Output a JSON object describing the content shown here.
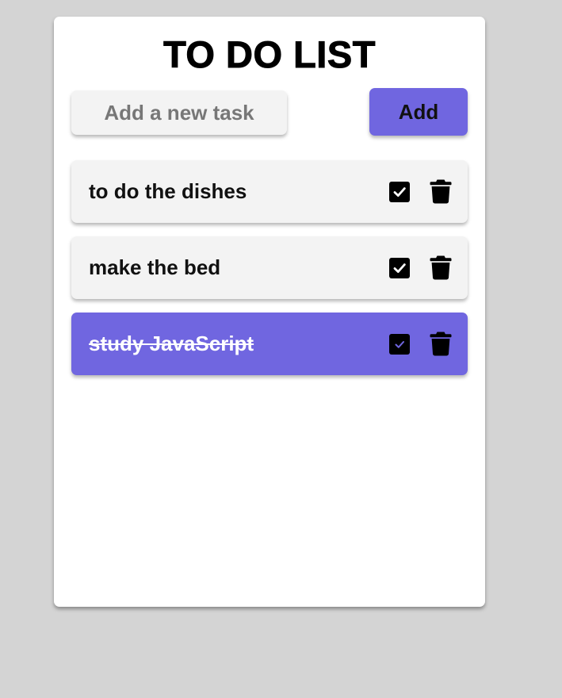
{
  "app": {
    "title": "TO DO LIST"
  },
  "new_task": {
    "placeholder": "Add a new task",
    "value": ""
  },
  "add_button": {
    "label": "Add"
  },
  "tasks": [
    {
      "text": "to do the dishes",
      "completed": false
    },
    {
      "text": "make the bed",
      "completed": false
    },
    {
      "text": "study JavaScript",
      "completed": true
    }
  ],
  "icons": {
    "check": "checkbox-check-icon",
    "delete": "trash-icon"
  },
  "colors": {
    "accent": "#7066e0",
    "background": "#d4d4d4",
    "card": "#ffffff",
    "item": "#f3f3f3"
  }
}
